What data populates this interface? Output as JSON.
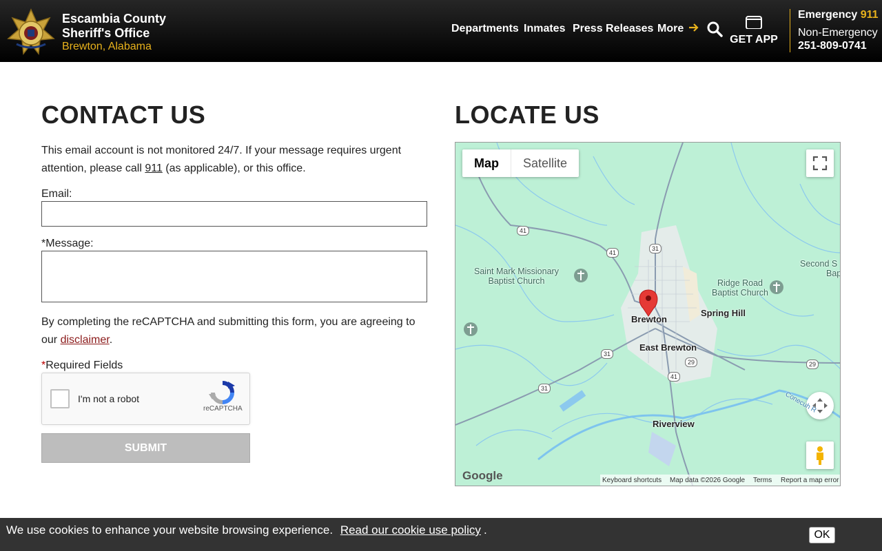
{
  "header": {
    "org_name_line1": "Escambia County",
    "org_name_line2": "Sheriff's Office",
    "org_location": "Brewton, Alabama",
    "nav": [
      "Departments",
      "Inmates",
      "Press Releases",
      "More"
    ],
    "get_app": "GET APP",
    "emergency_label": "Emergency",
    "emergency_number": "911",
    "non_emergency_label": "Non-Emergency",
    "non_emergency_number": "251-809-0741",
    "accent_color": "#e8b21c"
  },
  "contact": {
    "title": "CONTACT US",
    "intro_before": "This email account is not monitored 24/7. If your message requires urgent attention, please call ",
    "intro_link": "911",
    "intro_after": " (as applicable), or this office.",
    "email_label": "Email:",
    "email_value": "",
    "message_required": "*",
    "message_label": "Message:",
    "message_value": "",
    "agree_before": "By completing the reCAPTCHA and submitting this form, you are agreeing to our ",
    "agree_link": "disclaimer",
    "agree_after": ".",
    "required_star": "*",
    "required_text": "Required Fields",
    "recaptcha_label": "I'm not a robot",
    "recaptcha_brand": "reCAPTCHA",
    "submit": "SUBMIT"
  },
  "locate": {
    "title": "LOCATE US",
    "map_type_map": "Map",
    "map_type_satellite": "Satellite",
    "places": {
      "brewton": "Brewton",
      "east_brewton": "East Brewton",
      "spring_hill": "Spring Hill",
      "riverview": "Riverview",
      "saint_mark_1": "Saint Mark Missionary",
      "saint_mark_2": "Baptist Church",
      "ridge_road_1": "Ridge Road",
      "ridge_road_2": "Baptist Church",
      "second_1": "Second S",
      "second_2": "Bap",
      "conecuh": "Conecuh R"
    },
    "shields": [
      "41",
      "41",
      "31",
      "31",
      "31",
      "29",
      "29",
      "41"
    ],
    "google": "Google",
    "footer": {
      "shortcuts": "Keyboard shortcuts",
      "data": "Map data ©2026 Google",
      "terms": "Terms",
      "report": "Report a map error"
    }
  },
  "cookie": {
    "text": "We use cookies to enhance your website browsing experience.",
    "link": "Read our cookie use policy",
    "after": ".",
    "ok": "OK"
  }
}
